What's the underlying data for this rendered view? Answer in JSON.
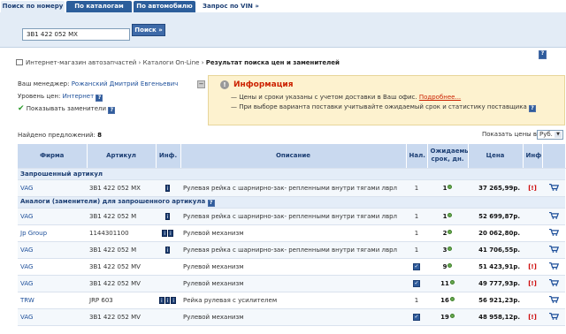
{
  "tabs": [
    {
      "label": "Поиск по номеру"
    },
    {
      "label": "По каталогам"
    },
    {
      "label": "По автомобилю"
    },
    {
      "label": "Запрос по VIN »"
    }
  ],
  "search": {
    "value": "3B1 422 052 MX",
    "button": "Поиск »"
  },
  "breadcrumb": {
    "items": [
      "Интернет-магазин автозапчастей",
      "Каталоги On-Line"
    ],
    "current": "Результат поиска цен и заменителей",
    "sep": "›"
  },
  "manager": {
    "label": "Ваш менеджер:",
    "name": "Рожанский Дмитрий Евгеньевич",
    "level_label": "Уровень цен:",
    "level": "Интернет",
    "show_subs": "Показывать заменители"
  },
  "info": {
    "collapse": "−",
    "icon": "!",
    "title": "Информация",
    "line1_prefix": "— Цены и сроки указаны с учетом доставки в Ваш офис.",
    "line1_link": "Подробнее...",
    "line2": "— При выборе варианта поставки учитывайте ожидаемый срок и статистику поставщика"
  },
  "found": {
    "label": "Найдено предложений:",
    "count": "8"
  },
  "prices_label": "Показать цены в",
  "currency": "Руб.",
  "headers": {
    "firm": "Фирма",
    "article": "Артикул",
    "inf": "Инф.",
    "desc": "Описание",
    "avail": "Нал.",
    "days": "Ожидаемый срок, дн.",
    "price": "Цена",
    "info": "Инф"
  },
  "sections": {
    "requested": "Запрошенный артикул",
    "analogs": "Аналоги (заменители) для запрошенного артикула"
  },
  "rows": [
    {
      "firm": "VAG",
      "article": "3B1 422 052 MX",
      "inf": "i",
      "desc": "Рулевая рейка с шарнирно-зак- репленными внутри тягами лврл",
      "avail": "1",
      "days": "1",
      "price": "37 265,99р.",
      "warn": "[!]"
    },
    {
      "firm": "VAG",
      "article": "3B1 422 052 M",
      "inf": "i",
      "desc": "Рулевая рейка с шарнирно-зак- репленными внутри тягами лврл",
      "avail": "1",
      "days": "1",
      "price": "52 699,87р.",
      "warn": ""
    },
    {
      "firm": "Jp Group",
      "article": "1144301100",
      "inf": "i i",
      "desc": "Рулевой механизм",
      "avail": "1",
      "days": "2",
      "price": "20 062,80р.",
      "warn": ""
    },
    {
      "firm": "VAG",
      "article": "3B1 422 052 M",
      "inf": "i",
      "desc": "Рулевая рейка с шарнирно-зак- репленными внутри тягами лврл",
      "avail": "1",
      "days": "3",
      "price": "41 706,55р.",
      "warn": ""
    },
    {
      "firm": "VAG",
      "article": "3B1 422 052 MV",
      "inf": "",
      "desc": "Рулевой механизм",
      "avail": "check",
      "days": "9",
      "price": "51 423,91р.",
      "warn": "[!]"
    },
    {
      "firm": "VAG",
      "article": "3B1 422 052 MV",
      "inf": "",
      "desc": "Рулевой механизм",
      "avail": "check",
      "days": "11",
      "price": "49 777,93р.",
      "warn": "[!]"
    },
    {
      "firm": "TRW",
      "article": "JRP 603",
      "inf": "i i i",
      "desc": "Рейка рулевая с усилителем",
      "avail": "1",
      "days": "16",
      "price": "56 921,23р.",
      "warn": ""
    },
    {
      "firm": "VAG",
      "article": "3B1 422 052 MV",
      "inf": "",
      "desc": "Рулевой механизм",
      "avail": "check",
      "days": "19",
      "price": "48 958,12р.",
      "warn": "[!]"
    }
  ]
}
